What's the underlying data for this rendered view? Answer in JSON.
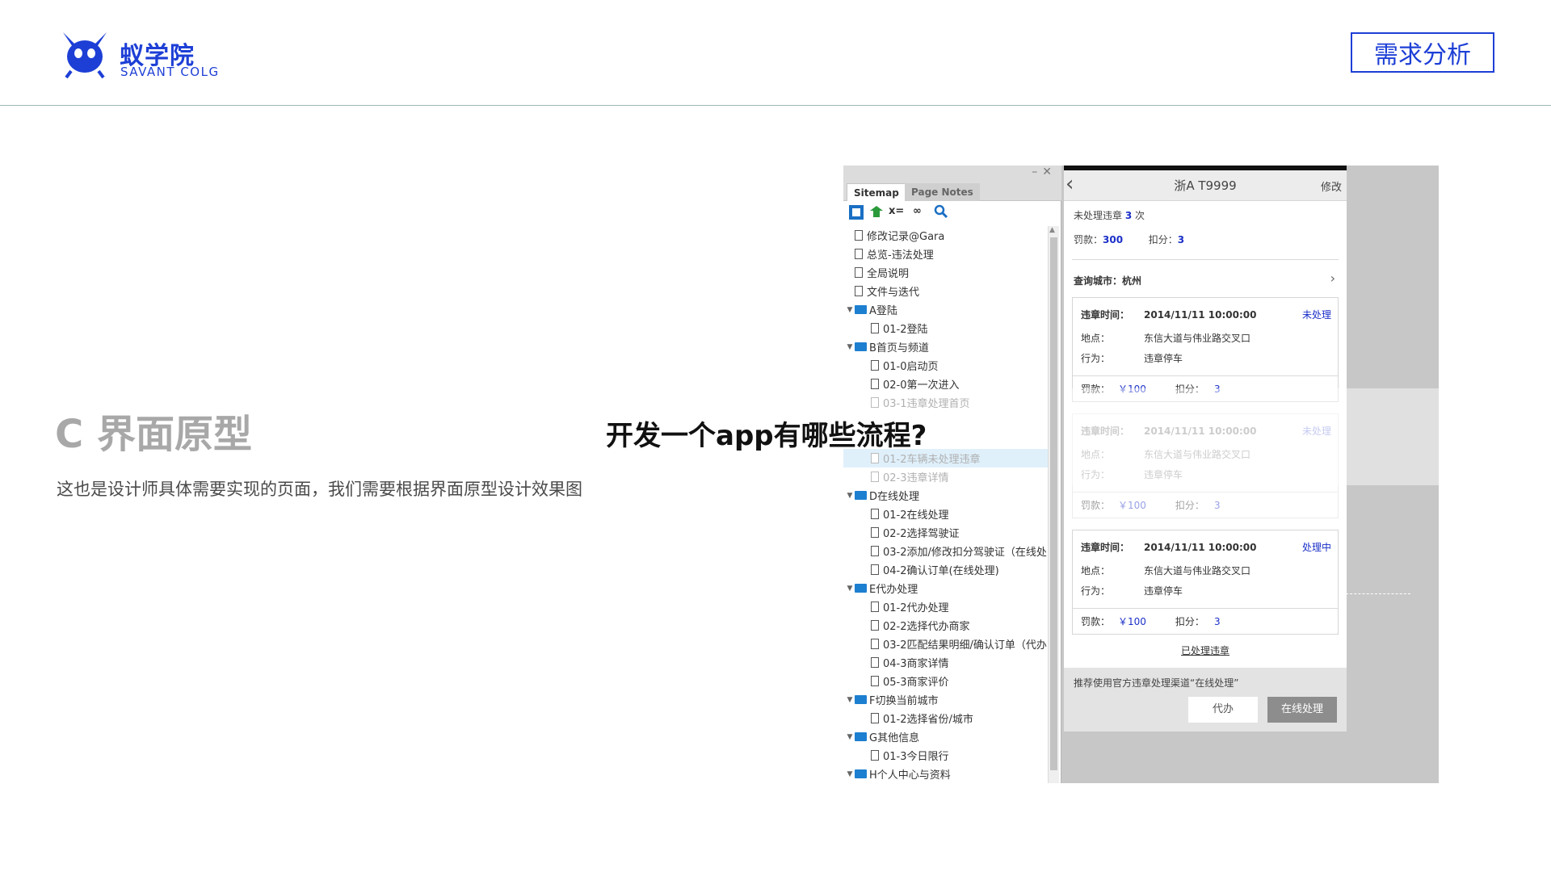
{
  "header": {
    "logo_cn": "蚁学院",
    "logo_en": "SAVANT COLG",
    "tag": "需求分析"
  },
  "main": {
    "title": "C 界面原型",
    "description": "这也是设计师具体需要实现的页面，我们需要根据界面原型设计效果图",
    "overlay_caption": "开发一个app有哪些流程?"
  },
  "sitemap": {
    "window_controls": "–✕",
    "tabs": [
      "Sitemap",
      "Page Notes"
    ],
    "tools": [
      "x=",
      "∞"
    ],
    "items": [
      {
        "label": "修改记录@Gara",
        "type": "page",
        "level": 0
      },
      {
        "label": "总览-违法处理",
        "type": "page",
        "level": 0
      },
      {
        "label": "全局说明",
        "type": "page",
        "level": 0
      },
      {
        "label": "文件与迭代",
        "type": "page",
        "level": 0
      },
      {
        "label": "A登陆",
        "type": "folder",
        "level": 0
      },
      {
        "label": "01-2登陆",
        "type": "page",
        "level": 1
      },
      {
        "label": "B首页与频道",
        "type": "folder",
        "level": 0
      },
      {
        "label": "01-0启动页",
        "type": "page",
        "level": 1
      },
      {
        "label": "02-0第一次进入",
        "type": "page",
        "level": 1
      },
      {
        "label": "03-1违章处理首页",
        "type": "page",
        "level": 1,
        "faded": true
      },
      {
        "label": "",
        "type": "blank",
        "level": 1
      },
      {
        "label": "",
        "type": "blank",
        "level": 1
      },
      {
        "label": "01-2车辆未处理违章",
        "type": "page",
        "level": 1,
        "faded": true,
        "selected": true
      },
      {
        "label": "02-3违章详情",
        "type": "page",
        "level": 1,
        "faded": true
      },
      {
        "label": "D在线处理",
        "type": "folder",
        "level": 0
      },
      {
        "label": "01-2在线处理",
        "type": "page",
        "level": 1
      },
      {
        "label": "02-2选择驾驶证",
        "type": "page",
        "level": 1
      },
      {
        "label": "03-2添加/修改扣分驾驶证（在线处",
        "type": "page",
        "level": 1
      },
      {
        "label": "04-2确认订单(在线处理)",
        "type": "page",
        "level": 1
      },
      {
        "label": "E代办处理",
        "type": "folder",
        "level": 0
      },
      {
        "label": "01-2代办处理",
        "type": "page",
        "level": 1
      },
      {
        "label": "02-2选择代办商家",
        "type": "page",
        "level": 1
      },
      {
        "label": "03-2匹配结果明细/确认订单（代办",
        "type": "page",
        "level": 1
      },
      {
        "label": "04-3商家详情",
        "type": "page",
        "level": 1
      },
      {
        "label": "05-3商家评价",
        "type": "page",
        "level": 1
      },
      {
        "label": "F切换当前城市",
        "type": "folder",
        "level": 0
      },
      {
        "label": "01-2选择省份/城市",
        "type": "page",
        "level": 1
      },
      {
        "label": "G其他信息",
        "type": "folder",
        "level": 0
      },
      {
        "label": "01-3今日限行",
        "type": "page",
        "level": 1
      },
      {
        "label": "H个人中心与资料",
        "type": "folder",
        "level": 0
      }
    ]
  },
  "phone": {
    "back": "‹",
    "title": "浙A T9999",
    "edit": "修改",
    "unprocessed_label": "未处理违章",
    "unprocessed_count": "3",
    "times_unit": "次",
    "fine_label": "罚款：",
    "fine_total": "300",
    "points_label": "扣分：",
    "points_total": "3",
    "city_label": "查询城市：杭州",
    "chevron": "›",
    "cards": [
      {
        "time_label": "违章时间：",
        "time": "2014/11/11  10:00:00",
        "status": "未处理",
        "place_label": "地点：",
        "place": "东信大道与伟业路交叉口",
        "act_label": "行为：",
        "act": "违章停车",
        "fine_label": "罚款：",
        "fine": "￥100",
        "points_label": "扣分：",
        "points": "3"
      },
      {
        "time_label": "违章时间：",
        "time": "2014/11/11  10:00:00",
        "status": "未处理",
        "place_label": "地点：",
        "place": "东信大道与伟业路交叉口",
        "act_label": "行为：",
        "act": "违章停车",
        "fine_label": "罚款：",
        "fine": "￥100",
        "points_label": "扣分：",
        "points": "3"
      },
      {
        "time_label": "违章时间：",
        "time": "2014/11/11  10:00:00",
        "status": "处理中",
        "place_label": "地点：",
        "place": "东信大道与伟业路交叉口",
        "act_label": "行为：",
        "act": "违章停车",
        "fine_label": "罚款：",
        "fine": "￥100",
        "points_label": "扣分：",
        "points": "3"
      }
    ],
    "processed_link": "已处理违章",
    "tip": "推荐使用官方违章处理渠道“在线处理”",
    "btn_agent": "代办",
    "btn_online": "在线处理"
  },
  "colors": {
    "brand_blue": "#1d3fd6",
    "link_blue": "#1a2fc8",
    "folder_blue": "#1d7fd0"
  },
  "icons": [
    "ant-logo-icon",
    "sitemap-page-icon",
    "add-page-icon",
    "link-icon",
    "search-icon",
    "folder-icon",
    "page-icon",
    "back-chevron-icon",
    "chevron-right-icon"
  ]
}
